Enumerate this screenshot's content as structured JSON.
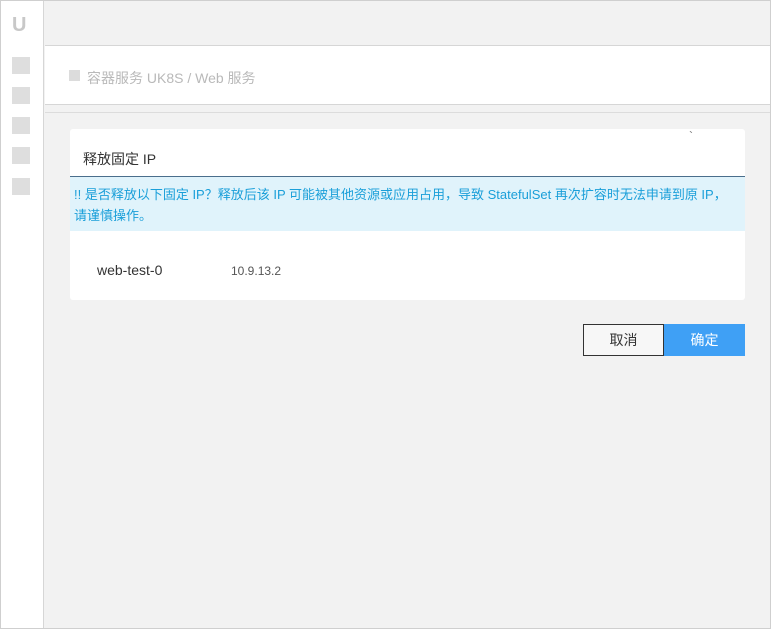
{
  "sidebar": {
    "logo": "U",
    "items": [
      "nav-1",
      "nav-2",
      "nav-3",
      "nav-4",
      "nav-5"
    ]
  },
  "header": {
    "breadcrumb": "容器服务 UK8S / Web 服务"
  },
  "modal": {
    "tick_mark": "`",
    "title": "释放固定 IP",
    "warning": "!! 是否释放以下固定 IP？释放后该 IP 可能被其他资源或应用占用，导致 StatefulSet 再次扩容时无法申请到原 IP，请谨慎操作。",
    "rows": [
      {
        "name": "web-test-0",
        "ip": "10.9.13.2"
      }
    ]
  },
  "buttons": {
    "cancel": "取消",
    "confirm": "确定"
  },
  "colors": {
    "primary": "#3fa0f5",
    "warning_text": "#1a9fd9",
    "warning_bg": "#e0f3fb"
  }
}
